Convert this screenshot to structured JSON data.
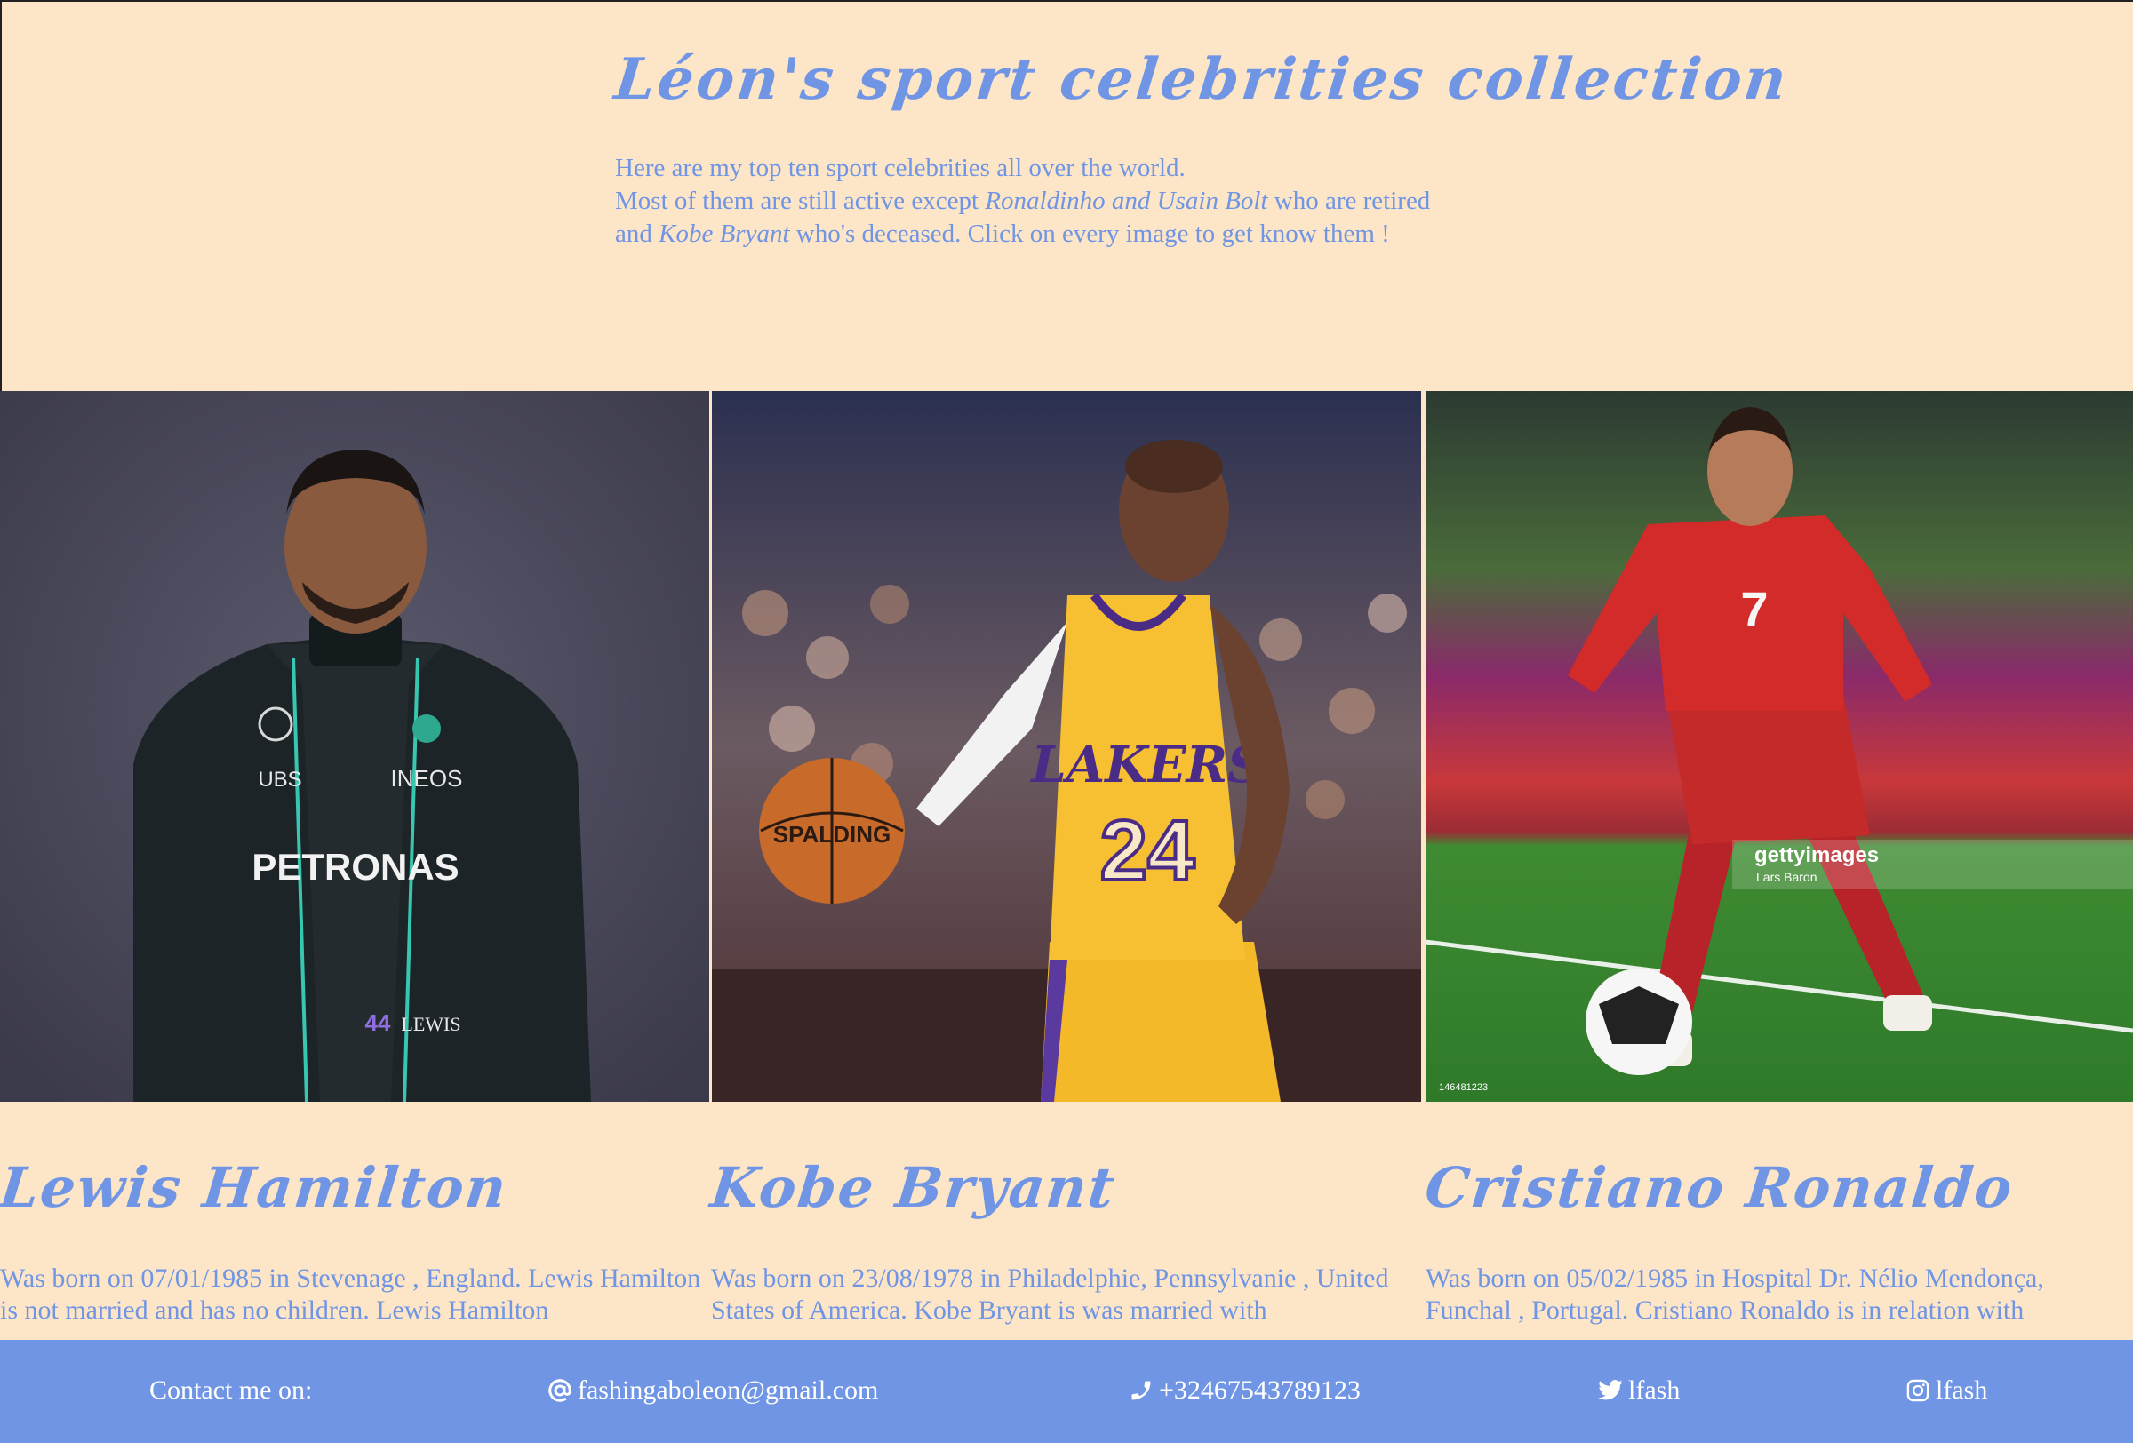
{
  "header": {
    "title": "Léon's sport celebrities collection",
    "intro_line1": "Here are my top ten sport celebrities all over the world.",
    "intro_line2_a": "Most of them are still active except ",
    "intro_line2_em": "Ronaldinho and Usain Bolt",
    "intro_line2_b": " who are retired",
    "intro_line3_a": "and ",
    "intro_line3_em": "Kobe Bryant",
    "intro_line3_b": " who's deceased. Click on every image to get know them !"
  },
  "cards": [
    {
      "name": "Lewis Hamilton",
      "bio": "Was born on 07/01/1985 in Stevenage , England. Lewis Hamilton is not married and has no children. Lewis Hamilton",
      "suit_text": "PETRONAS",
      "suit_brand": "INEOS",
      "suit_sponsor": "UBS",
      "suit_name": "LEWIS",
      "suit_number": "44"
    },
    {
      "name": "Kobe Bryant",
      "bio": "Was born on 23/08/1978 in Philadelphie, Pennsylvanie , United States of America. Kobe Bryant is was married with",
      "jersey_team": "LAKERS",
      "jersey_number": "24",
      "ball_brand": "SPALDING"
    },
    {
      "name": "Cristiano Ronaldo",
      "bio": "Was born on 05/02/1985 in Hospital Dr. Nélio Mendonça, Funchal , Portugal. Cristiano Ronaldo is in relation with",
      "jersey_number": "7",
      "watermark": "gettyimages",
      "watermark_credit": "Lars Baron",
      "image_id": "146481223"
    }
  ],
  "footer": {
    "contact_label": "Contact me on:",
    "email": "fashingaboleon@gmail.com",
    "phone": "+32467543789123",
    "twitter": "lfash",
    "instagram": "lfash"
  },
  "colors": {
    "background": "#fde5c7",
    "accent": "#6f95e4",
    "footer_text": "#ffffff"
  },
  "icons": {
    "email": "at-icon",
    "phone": "phone-icon",
    "twitter": "twitter-icon",
    "instagram": "instagram-icon"
  }
}
